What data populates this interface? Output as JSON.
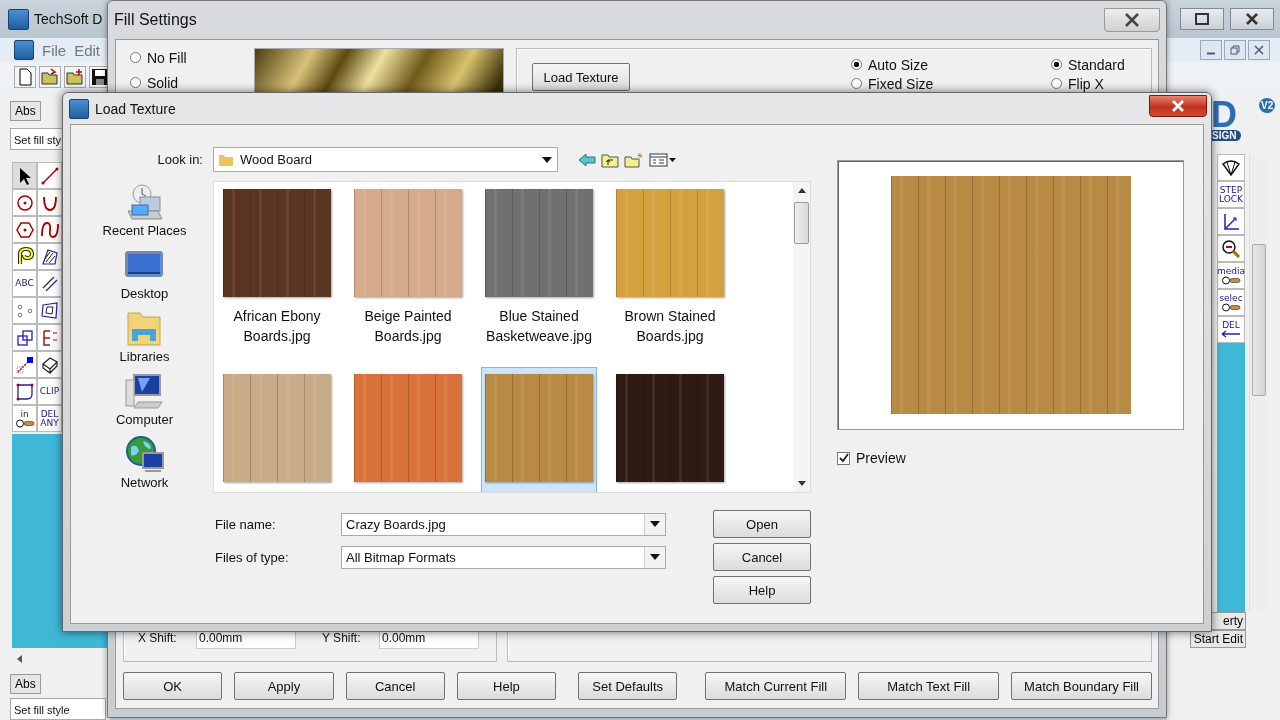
{
  "app": {
    "title": "TechSoft D",
    "menu": [
      "File",
      "Edit"
    ],
    "abs_label": "Abs",
    "status_top": "Set fill sty",
    "left_tools": [
      {
        "kind": "icon"
      },
      {
        "kind": "icon"
      },
      {
        "kind": "icon"
      },
      {
        "kind": "icon"
      },
      {
        "kind": "icon"
      },
      {
        "kind": "icon"
      },
      {
        "kind": "icon"
      },
      {
        "kind": "icon"
      },
      {
        "kind": "text",
        "label": "ABC"
      },
      {
        "kind": "icon"
      },
      {
        "kind": "icon"
      },
      {
        "kind": "icon"
      },
      {
        "kind": "icon"
      },
      {
        "kind": "icon"
      },
      {
        "kind": "icon"
      },
      {
        "kind": "icon"
      },
      {
        "kind": "icon"
      },
      {
        "kind": "text",
        "label": "CLIP"
      },
      {
        "kind": "toggle",
        "label": "in"
      },
      {
        "kind": "text",
        "label": "DEL ANY"
      }
    ],
    "right_tools": [
      {
        "kind": "icon"
      },
      {
        "kind": "text",
        "label": "STEP LOCK"
      },
      {
        "kind": "icon"
      },
      {
        "kind": "icon"
      },
      {
        "kind": "toggle",
        "label": "media"
      },
      {
        "kind": "toggle",
        "label": "selec"
      },
      {
        "kind": "arrow",
        "label": "DEL"
      }
    ],
    "brand": {
      "mark": "D",
      "badge": "V2",
      "word": "SIGN"
    },
    "side_buttons": [
      "erty",
      "Start Edit"
    ],
    "abs_bottom": "Abs",
    "status_bottom": "Set fill style"
  },
  "fill_settings": {
    "title": "Fill Settings",
    "fill_types": [
      {
        "label": "No Fill",
        "selected": false
      },
      {
        "label": "Solid",
        "selected": false
      }
    ],
    "load_button": "Load Texture",
    "size_modes": [
      {
        "label": "Auto Size",
        "selected": true
      },
      {
        "label": "Fixed Size",
        "selected": false
      }
    ],
    "orientations": [
      {
        "label": "Standard",
        "selected": true
      },
      {
        "label": "Flip X",
        "selected": false
      }
    ],
    "x_shift": {
      "label": "X Shift:",
      "value": "0.00mm"
    },
    "y_shift": {
      "label": "Y Shift:",
      "value": "0.00mm"
    },
    "buttons": [
      "OK",
      "Apply",
      "Cancel",
      "Help",
      "Set Defaults",
      "Match Current Fill",
      "Match Text Fill",
      "Match Boundary Fill"
    ]
  },
  "load_texture": {
    "title": "Load Texture",
    "look_in": {
      "label": "Look in:",
      "value": "Wood Board"
    },
    "places": [
      {
        "kind": "recent",
        "label": "Recent Places"
      },
      {
        "kind": "desktop",
        "label": "Desktop"
      },
      {
        "kind": "libraries",
        "label": "Libraries"
      },
      {
        "kind": "computer",
        "label": "Computer"
      },
      {
        "kind": "network",
        "label": "Network"
      }
    ],
    "files": [
      {
        "label": "African Ebony Boards.jpg",
        "color": "#5a3522",
        "selected": false
      },
      {
        "label": "Beige Painted Boards.jpg",
        "color": "#d6ab8c",
        "selected": false
      },
      {
        "label": "Blue Stained Basketweave.jpg",
        "color": "#707072",
        "selected": false
      },
      {
        "label": "Brown Stained Boards.jpg",
        "color": "#d3a23e",
        "selected": false
      },
      {
        "color": "#c8ab88",
        "selected": false
      },
      {
        "color": "#d9713a",
        "selected": false
      },
      {
        "color": "#b88a44",
        "selected": true
      },
      {
        "color": "#2f1b13",
        "selected": false
      }
    ],
    "file_name": {
      "label": "File name:",
      "value": "Crazy Boards.jpg"
    },
    "file_type": {
      "label": "Files of type:",
      "value": "All Bitmap Formats"
    },
    "buttons": [
      "Open",
      "Cancel",
      "Help"
    ],
    "preview": {
      "label": "Preview",
      "checked": true
    }
  }
}
